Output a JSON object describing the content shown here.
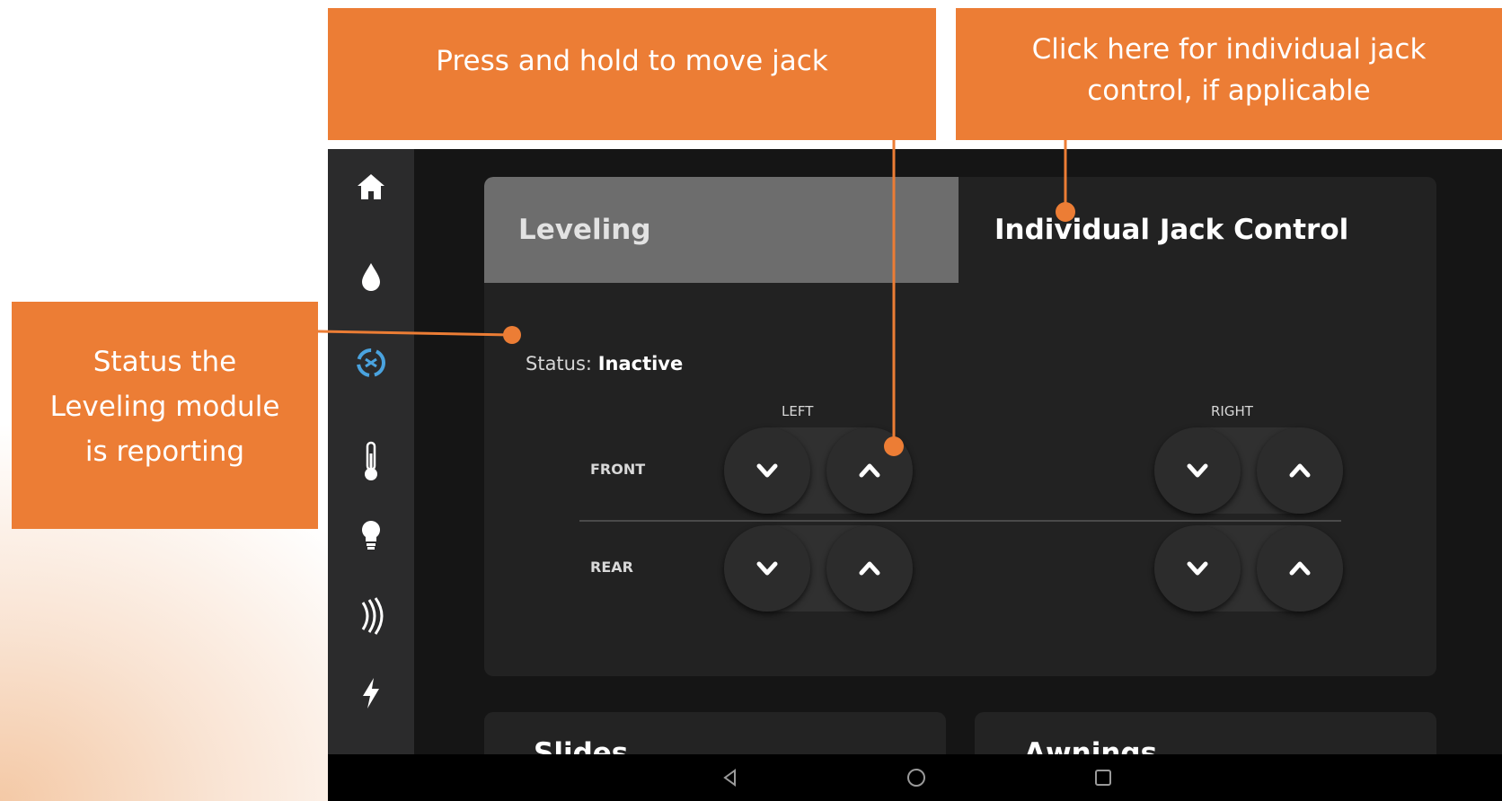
{
  "callouts": {
    "move_jack": "Press and hold to move jack",
    "individual_jack_line1": "Click here for individual jack",
    "individual_jack_line2": "control, if applicable",
    "status_line1": "Status the",
    "status_line2": "Leveling module",
    "status_line3": "is reporting"
  },
  "sidebar": {
    "items": [
      {
        "icon": "home-icon"
      },
      {
        "icon": "water-drop-icon"
      },
      {
        "icon": "leveling-icon",
        "active": true
      },
      {
        "icon": "thermometer-icon"
      },
      {
        "icon": "lightbulb-icon"
      },
      {
        "icon": "signal-icon"
      },
      {
        "icon": "lightning-icon"
      }
    ]
  },
  "leveling": {
    "tabs": {
      "leveling": "Leveling",
      "individual_jack_control": "Individual Jack Control"
    },
    "status_label": "Status:",
    "status_value": "Inactive",
    "columns": {
      "left": "LEFT",
      "right": "RIGHT"
    },
    "rows": {
      "front": "FRONT",
      "rear": "REAR"
    }
  },
  "cards": {
    "slides": "Slides",
    "awnings": "Awnings"
  },
  "colors": {
    "callout": "#ec7d35",
    "accent_icon": "#4aa3df",
    "tablet_bg": "#151515",
    "card_bg": "#222222",
    "active_tab": "#6d6d6d"
  }
}
